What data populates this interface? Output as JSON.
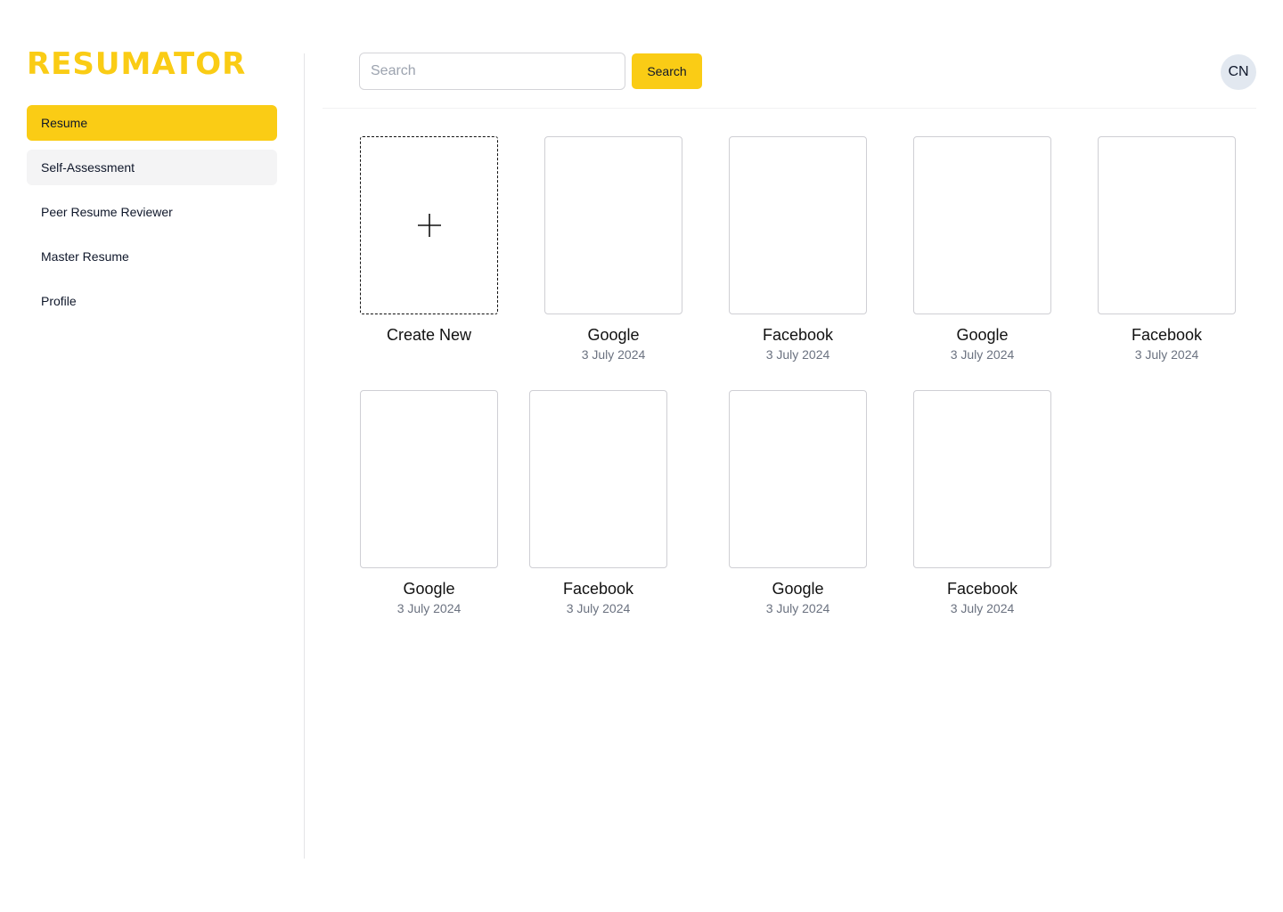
{
  "brand": {
    "name": "RESUMATOR",
    "accent_color": "#FACC15"
  },
  "sidebar": {
    "items": [
      {
        "label": "Resume",
        "active": true
      },
      {
        "label": "Self-Assessment",
        "hovered": true
      },
      {
        "label": "Peer Resume Reviewer"
      },
      {
        "label": "Master Resume"
      },
      {
        "label": "Profile"
      }
    ]
  },
  "header": {
    "search_placeholder": "Search",
    "search_value": "",
    "search_button_label": "Search",
    "avatar_initials": "CN"
  },
  "create_card": {
    "label": "Create New",
    "icon": "plus-icon"
  },
  "resumes": [
    {
      "title": "Google",
      "date": "3 July 2024"
    },
    {
      "title": "Facebook",
      "date": "3 July 2024"
    },
    {
      "title": "Google",
      "date": "3 July 2024"
    },
    {
      "title": "Facebook",
      "date": "3 July 2024"
    },
    {
      "title": "Google",
      "date": "3 July 2024"
    },
    {
      "title": "Facebook",
      "date": "3 July 2024"
    },
    {
      "title": "Google",
      "date": "3 July 2024"
    },
    {
      "title": "Facebook",
      "date": "3 July 2024"
    }
  ]
}
